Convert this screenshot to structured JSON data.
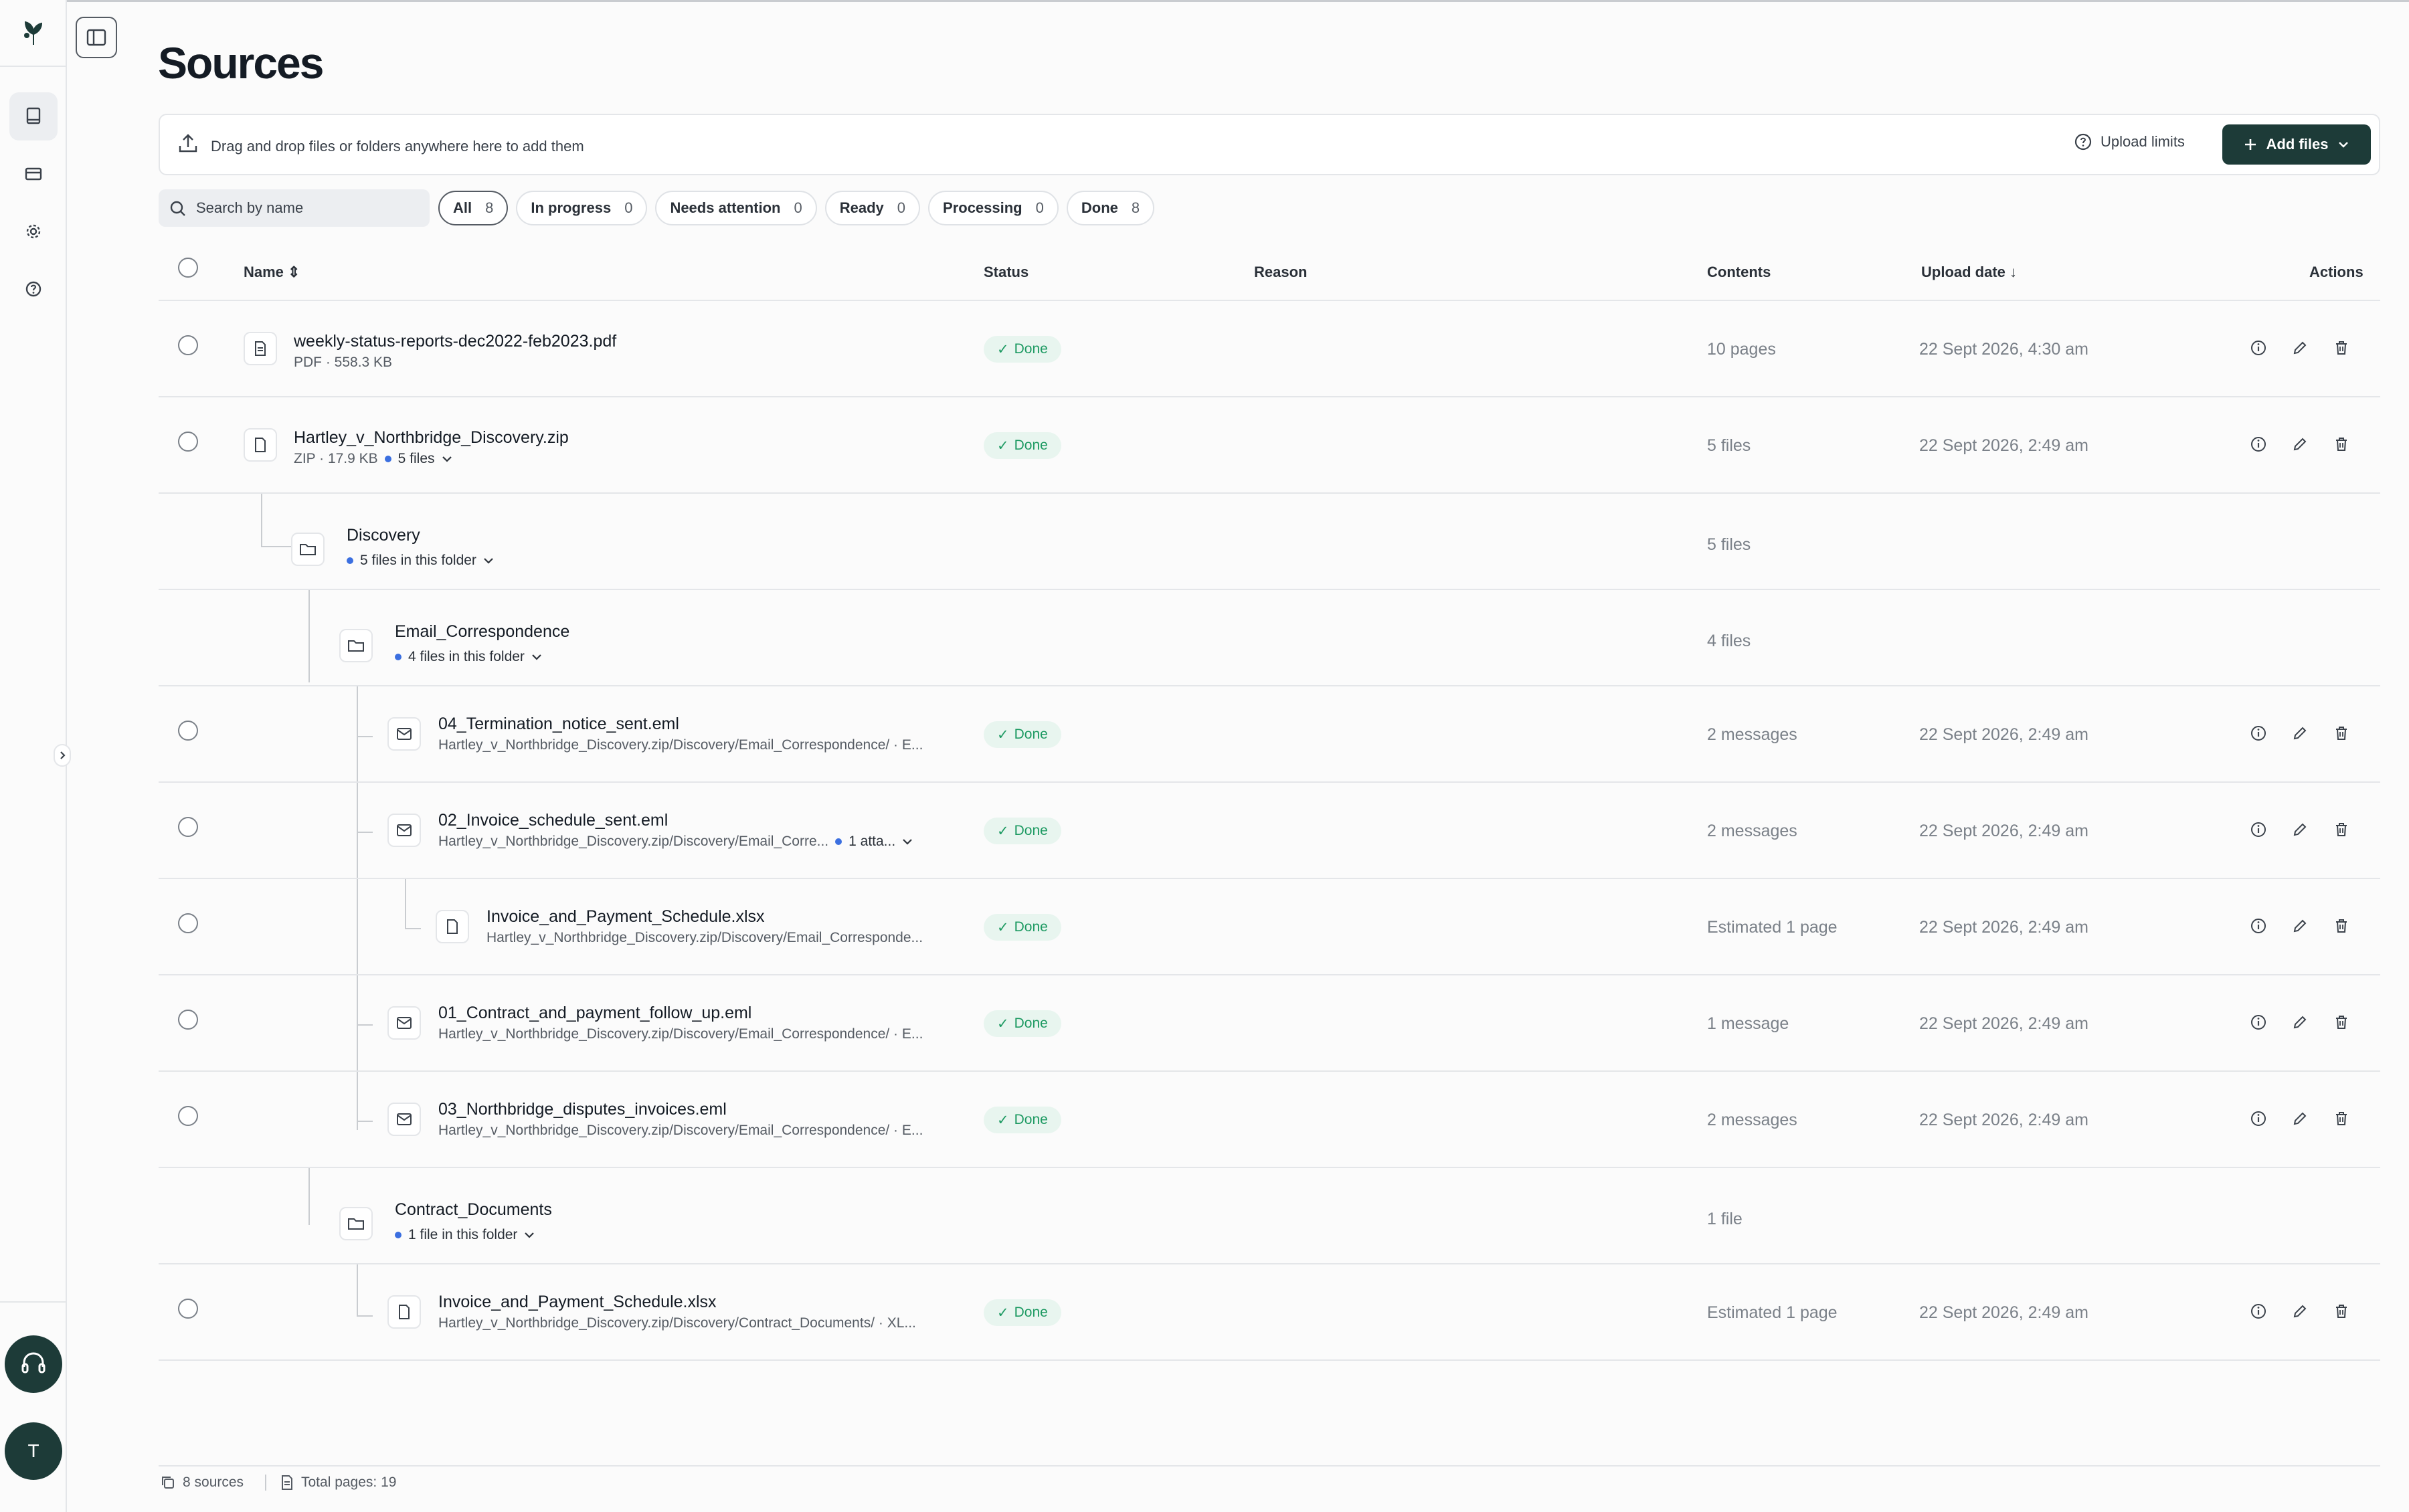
{
  "page_title": "Sources",
  "upload": {
    "drop_text": "Drag and drop files or folders anywhere here to add them",
    "limits_label": "Upload limits",
    "add_label": "Add files"
  },
  "search": {
    "placeholder": "Search by name"
  },
  "filters": [
    {
      "label": "All",
      "count": "8"
    },
    {
      "label": "In progress",
      "count": "0"
    },
    {
      "label": "Needs attention",
      "count": "0"
    },
    {
      "label": "Ready",
      "count": "0"
    },
    {
      "label": "Processing",
      "count": "0"
    },
    {
      "label": "Done",
      "count": "8"
    }
  ],
  "columns": {
    "name": "Name",
    "status": "Status",
    "reason": "Reason",
    "contents": "Contents",
    "upload_date": "Upload date",
    "actions": "Actions"
  },
  "rows": [
    {
      "name": "weekly-status-reports-dec2022-feb2023.pdf",
      "meta": "PDF · 558.3 KB",
      "status": "Done",
      "contents": "10 pages",
      "date": "22 Sept 2026, 4:30 am"
    },
    {
      "name": "Hartley_v_Northbridge_Discovery.zip",
      "meta": "ZIP · 17.9 KB",
      "extra": "5 files",
      "status": "Done",
      "contents": "5 files",
      "date": "22 Sept 2026, 2:49 am"
    },
    {
      "name": "Discovery",
      "extra": "5 files in this folder",
      "contents": "5 files"
    },
    {
      "name": "Email_Correspondence",
      "extra": "4 files in this folder",
      "contents": "4 files"
    },
    {
      "name": "04_Termination_notice_sent.eml",
      "meta": "Hartley_v_Northbridge_Discovery.zip/Discovery/Email_Correspondence/ · E...",
      "status": "Done",
      "contents": "2 messages",
      "date": "22 Sept 2026, 2:49 am"
    },
    {
      "name": "02_Invoice_schedule_sent.eml",
      "meta": "Hartley_v_Northbridge_Discovery.zip/Discovery/Email_Corre...",
      "extra": "1 atta...",
      "status": "Done",
      "contents": "2 messages",
      "date": "22 Sept 2026, 2:49 am"
    },
    {
      "name": "Invoice_and_Payment_Schedule.xlsx",
      "meta": "Hartley_v_Northbridge_Discovery.zip/Discovery/Email_Corresponde...",
      "status": "Done",
      "contents": "Estimated 1 page",
      "date": "22 Sept 2026, 2:49 am"
    },
    {
      "name": "01_Contract_and_payment_follow_up.eml",
      "meta": "Hartley_v_Northbridge_Discovery.zip/Discovery/Email_Correspondence/ · E...",
      "status": "Done",
      "contents": "1 message",
      "date": "22 Sept 2026, 2:49 am"
    },
    {
      "name": "03_Northbridge_disputes_invoices.eml",
      "meta": "Hartley_v_Northbridge_Discovery.zip/Discovery/Email_Correspondence/ · E...",
      "status": "Done",
      "contents": "2 messages",
      "date": "22 Sept 2026, 2:49 am"
    },
    {
      "name": "Contract_Documents",
      "extra": "1 file in this folder",
      "contents": "1 file"
    },
    {
      "name": "Invoice_and_Payment_Schedule.xlsx",
      "meta": "Hartley_v_Northbridge_Discovery.zip/Discovery/Contract_Documents/ · XL...",
      "status": "Done",
      "contents": "Estimated 1 page",
      "date": "22 Sept 2026, 2:49 am"
    }
  ],
  "footer": {
    "sources": "8 sources",
    "pages": "Total pages: 19"
  },
  "user": {
    "initial": "T"
  },
  "colors": {
    "brand": "#1d3b38",
    "done_bg": "#e8f5ef",
    "done_text": "#1d9a62",
    "dot": "#3b6fe0"
  }
}
